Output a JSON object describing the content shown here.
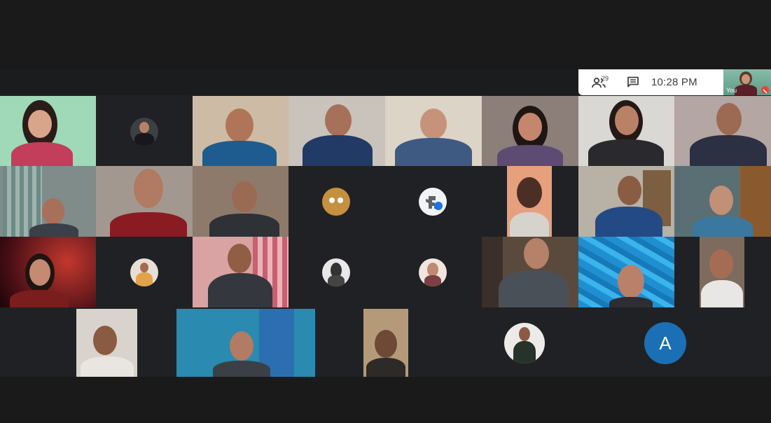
{
  "meeting": {
    "participant_count": "29",
    "time": "10:28 PM",
    "self_label": "You",
    "avatar_letter": "A"
  },
  "colors": {
    "stage_bg": "#202124",
    "control_bar_bg": "#ffffff",
    "mic_off_red": "#ea4335",
    "avatar_blue": "#1a6fb5"
  },
  "icons": [
    "people-icon",
    "chat-icon",
    "mic-off-icon"
  ]
}
